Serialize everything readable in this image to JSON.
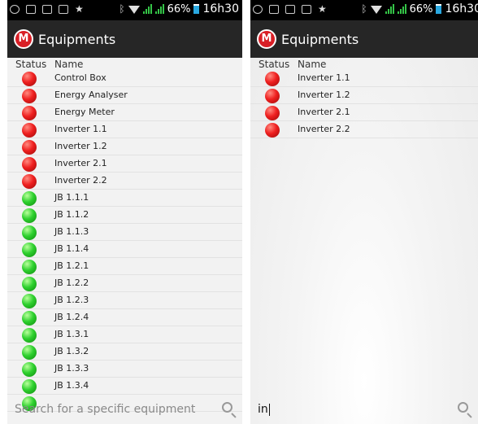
{
  "status_bar": {
    "battery": "66%",
    "time": "16h30"
  },
  "app": {
    "title": "Equipments",
    "logo_letter": "M"
  },
  "columns": {
    "status": "Status",
    "name": "Name"
  },
  "left_list": [
    {
      "name": "Control Box",
      "status": "red"
    },
    {
      "name": "Energy Analyser",
      "status": "red"
    },
    {
      "name": "Energy Meter",
      "status": "red"
    },
    {
      "name": "Inverter 1.1",
      "status": "red"
    },
    {
      "name": "Inverter 1.2",
      "status": "red"
    },
    {
      "name": "Inverter 2.1",
      "status": "red"
    },
    {
      "name": "Inverter 2.2",
      "status": "red"
    },
    {
      "name": "JB 1.1.1",
      "status": "green"
    },
    {
      "name": "JB 1.1.2",
      "status": "green"
    },
    {
      "name": "JB 1.1.3",
      "status": "green"
    },
    {
      "name": "JB 1.1.4",
      "status": "green"
    },
    {
      "name": "JB 1.2.1",
      "status": "green"
    },
    {
      "name": "JB 1.2.2",
      "status": "green"
    },
    {
      "name": "JB 1.2.3",
      "status": "green"
    },
    {
      "name": "JB 1.2.4",
      "status": "green"
    },
    {
      "name": "JB 1.3.1",
      "status": "green"
    },
    {
      "name": "JB 1.3.2",
      "status": "green"
    },
    {
      "name": "JB 1.3.3",
      "status": "green"
    },
    {
      "name": "JB 1.3.4",
      "status": "green"
    },
    {
      "name": "",
      "status": "green"
    }
  ],
  "right_list": [
    {
      "name": "Inverter 1.1",
      "status": "red"
    },
    {
      "name": "Inverter 1.2",
      "status": "red"
    },
    {
      "name": "Inverter 2.1",
      "status": "red"
    },
    {
      "name": "Inverter 2.2",
      "status": "red"
    }
  ],
  "search": {
    "placeholder": "Search for a specific equipment",
    "typed_value": "in",
    "icon": "magnifier-icon"
  },
  "colors": {
    "alarm": "#ef2020",
    "ok": "#2fd12f",
    "actionbar": "#262626",
    "battery": "#29a8e0",
    "signal": "#34c447"
  }
}
